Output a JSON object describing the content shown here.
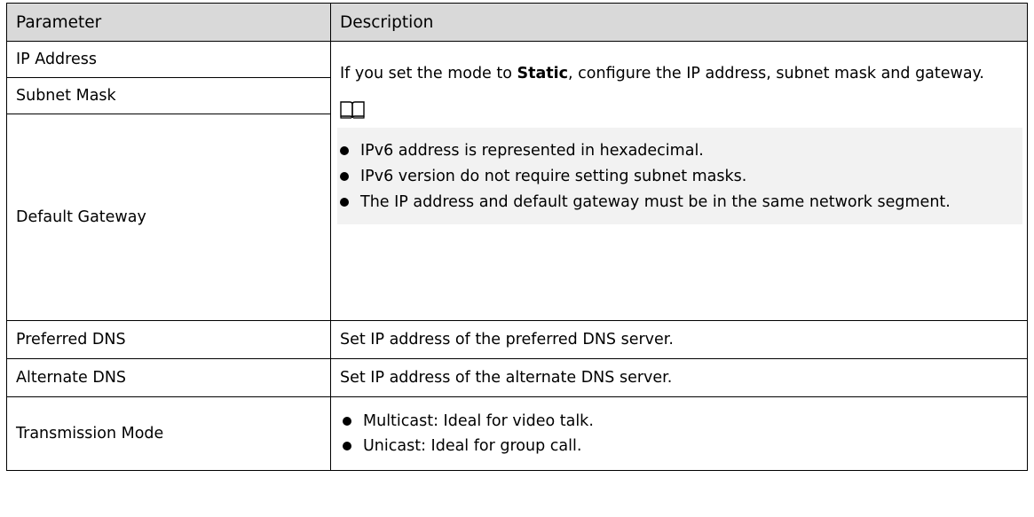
{
  "header": {
    "parameter": "Parameter",
    "description": "Description"
  },
  "rows": {
    "ip_address": "IP Address",
    "subnet_mask": "Subnet Mask",
    "default_gateway": "Default Gateway",
    "preferred_dns": "Preferred DNS",
    "alternate_dns": "Alternate DNS",
    "transmission_mode": "Transmission Mode"
  },
  "static_desc": {
    "prefix": "If you set the mode to ",
    "bold": "Static",
    "suffix": ", configure the IP address, subnet mask and gateway."
  },
  "note": {
    "icon": "book-icon",
    "bullets": [
      "IPv6 address is represented in hexadecimal.",
      "IPv6 version do not require setting subnet masks.",
      "The IP address and default gateway must be in the same network segment."
    ]
  },
  "preferred_dns_desc": "Set IP address of the preferred DNS server.",
  "alternate_dns_desc": "Set IP address of the alternate DNS server.",
  "transmission_bullets": [
    "Multicast: Ideal for video talk.",
    "Unicast: Ideal for group call."
  ],
  "colors": {
    "header_bg": "#d9d9d9",
    "note_bg": "#f2f2f2",
    "border": "#000000"
  }
}
